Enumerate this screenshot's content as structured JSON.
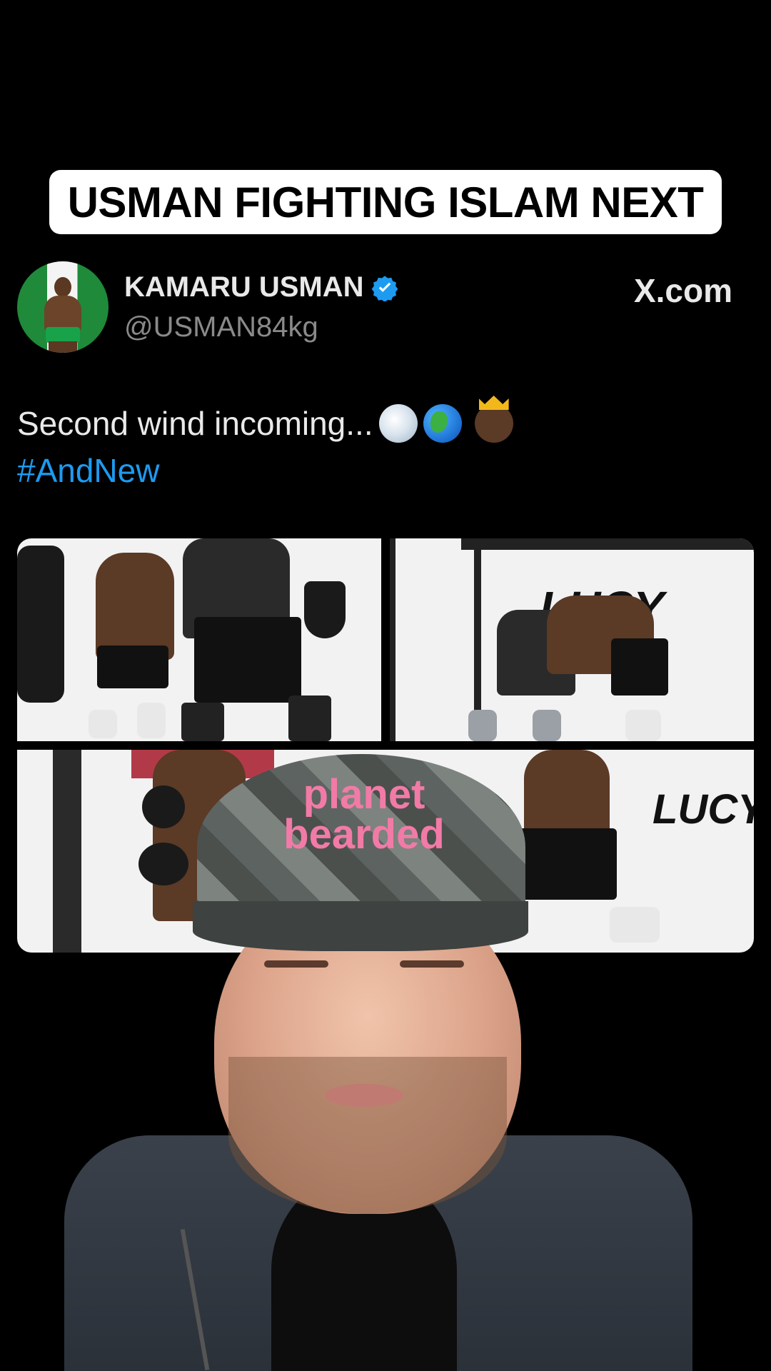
{
  "headline": "USMAN FIGHTING ISLAM NEXT",
  "tweet": {
    "author_name": "KAMARU USMAN",
    "handle": "@USMAN84kg",
    "source": "X.com",
    "text": "Second wind incoming...",
    "emojis": [
      "wind-face-emoji",
      "globe-emoji",
      "crowned-man-emoji"
    ],
    "hashtag": "#AndNew",
    "verified_color": "#1d9bf0"
  },
  "photos": {
    "photo2_wall_text": "LUCY",
    "photo3_wall_text": "LUCY"
  },
  "presenter": {
    "cap_text_line1": "planet",
    "cap_text_line2": "bearded"
  }
}
